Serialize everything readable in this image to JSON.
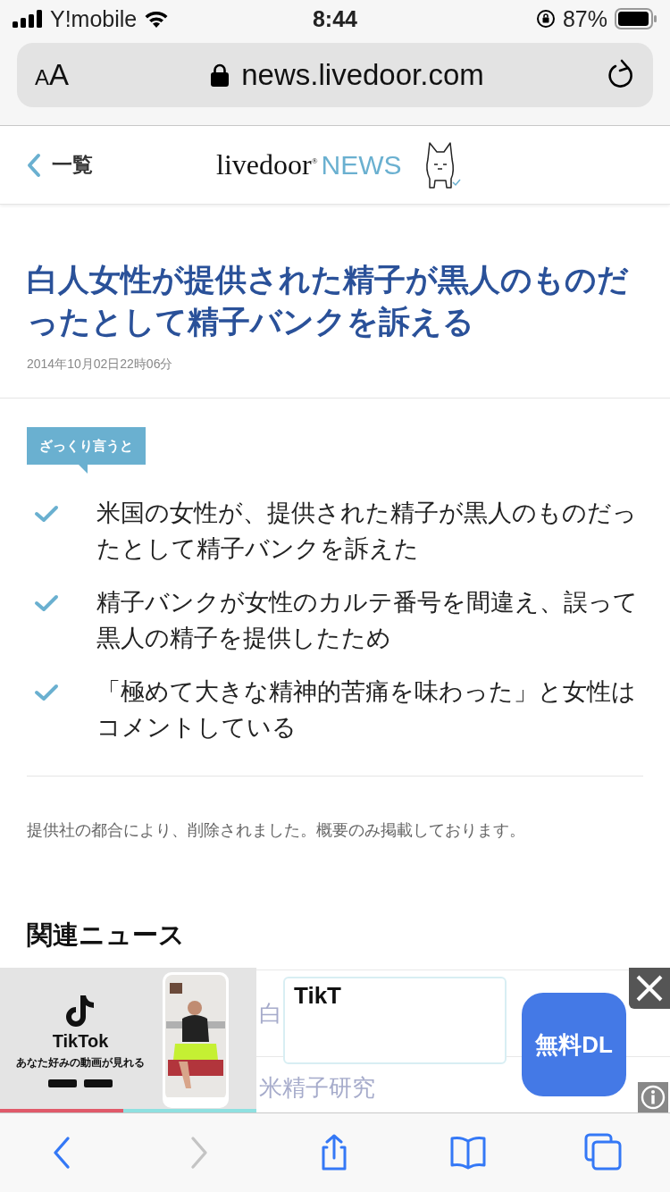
{
  "status_bar": {
    "carrier": "Y!mobile",
    "time": "8:44",
    "battery": "87%"
  },
  "address_bar": {
    "text_size_button": "AA",
    "url": "news.livedoor.com"
  },
  "header": {
    "back_link": "一覧",
    "logo_word": "livedoor$^{®}$",
    "logo_news": "NEWS"
  },
  "article": {
    "title": "白人女性が提供された精子が黒人のものだったとして精子バンクを訴える",
    "date": "2014年10月02日22時06分",
    "summary_badge": "ざっくり言うと",
    "summary": [
      "米国の女性が、提供された精子が黒人のものだったとして精子バンクを訴えた",
      "精子バンクが女性のカルテ番号を間違え、誤って黒人の精子を提供したため",
      "「極めて大きな精神的苦痛を味わった」と女性はコメントしている"
    ],
    "note": "提供社の都合により、削除されました。概要のみ掲載しております。"
  },
  "related": {
    "heading": "関連ニュース",
    "items": [
      "白",
      "米精子研究"
    ]
  },
  "ad": {
    "brand": "TikTok",
    "tagline": "あなた好みの動画が見れる",
    "field_text": "TikT",
    "button": "無料DL"
  },
  "toolbar": [
    {
      "kind": "back",
      "disabled": false
    },
    {
      "kind": "forward",
      "disabled": true
    },
    {
      "kind": "share",
      "disabled": false
    },
    {
      "kind": "bookmarks",
      "disabled": false
    },
    {
      "kind": "tabs",
      "disabled": false
    }
  ]
}
